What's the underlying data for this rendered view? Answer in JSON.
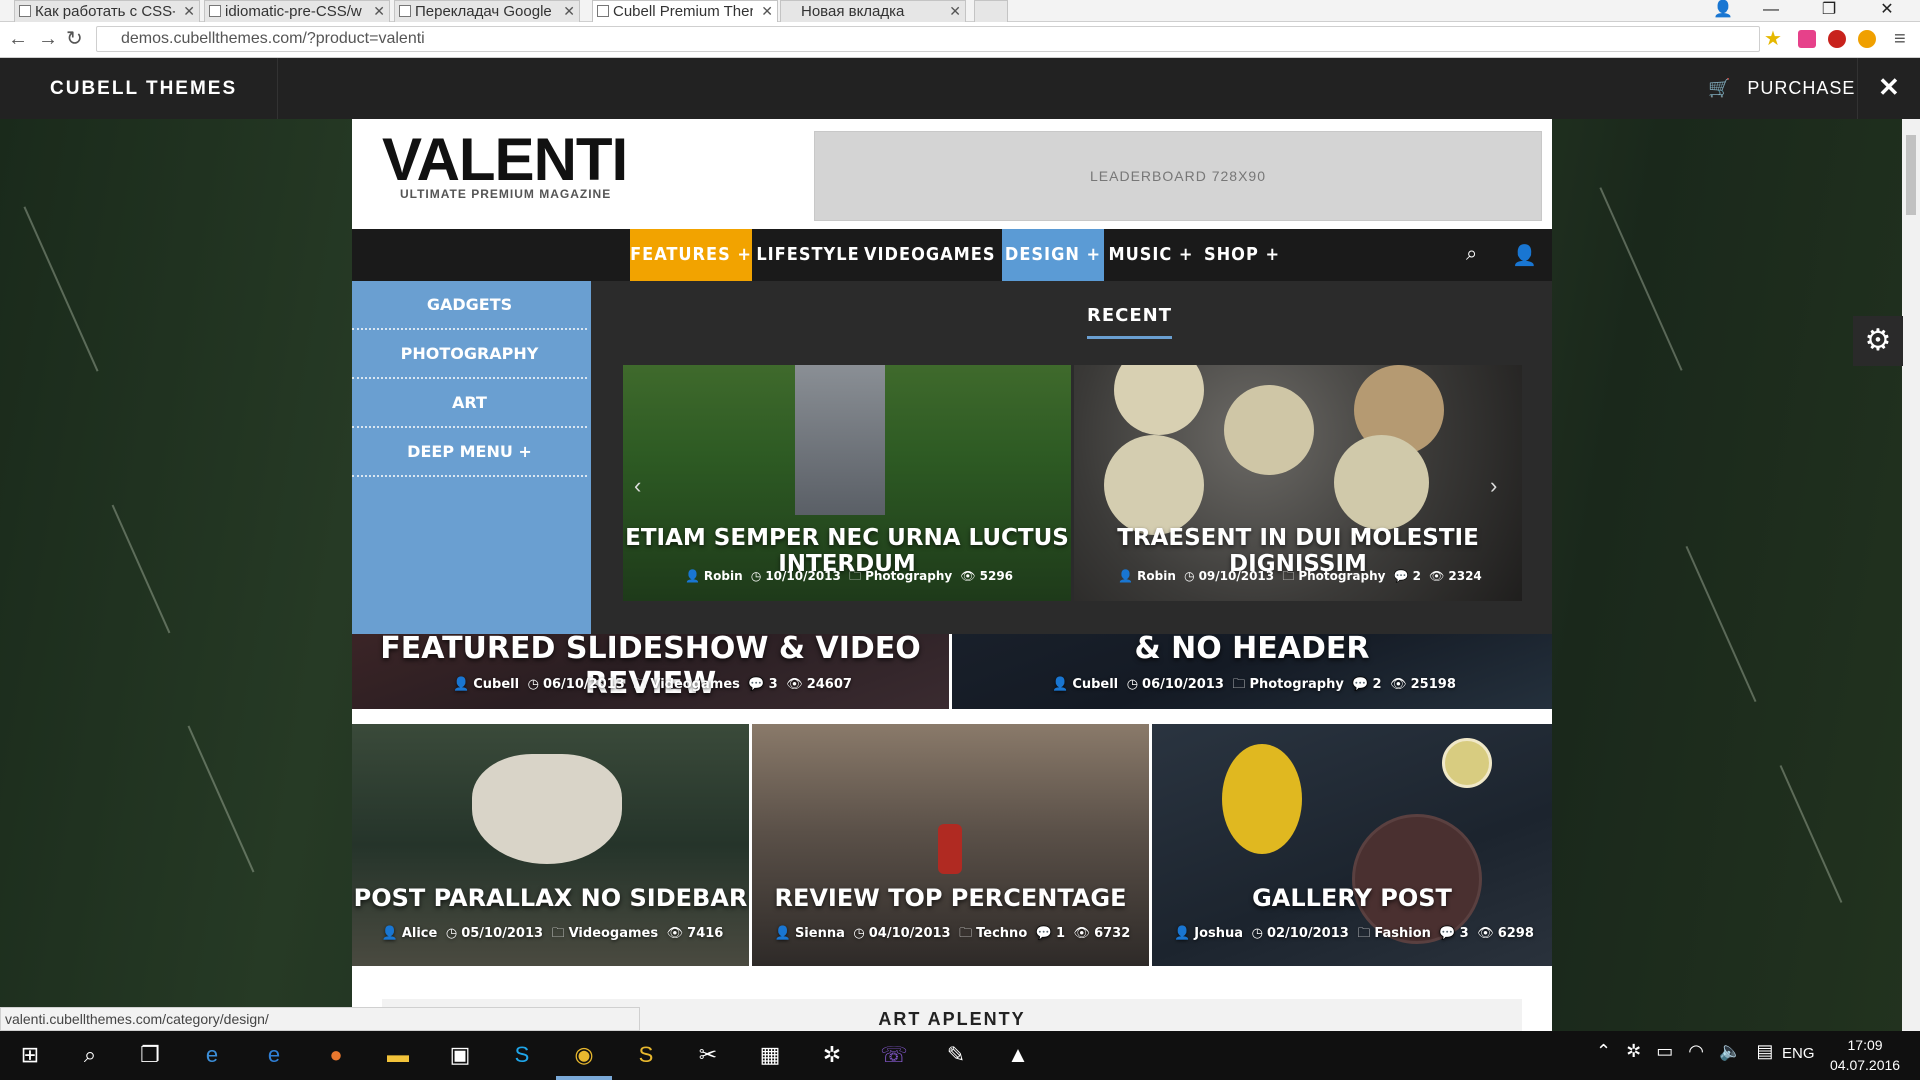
{
  "browser": {
    "tabs": [
      {
        "title": "Как работать с CSS-"
      },
      {
        "title": "idiomatic-pre-CSS/w"
      },
      {
        "title": "Перекладач Google"
      },
      {
        "title": "Cubell Premium Ther"
      },
      {
        "title": "Новая вкладка"
      }
    ],
    "url": "demos.cubellthemes.com/?product=valenti",
    "status_url": "valenti.cubellthemes.com/category/design/"
  },
  "sitebar": {
    "brand": "CUBELL THEMES",
    "purchase": "PURCHASE"
  },
  "logo": {
    "main": "VALENTI",
    "sub": "ULTIMATE PREMIUM MAGAZINE"
  },
  "leaderboard": "LEADERBOARD 728X90",
  "nav": {
    "items": [
      {
        "label": "FEATURES +"
      },
      {
        "label": "LIFESTYLE +"
      },
      {
        "label": "VIDEOGAMES"
      },
      {
        "label": "DESIGN +"
      },
      {
        "label": "MUSIC +"
      },
      {
        "label": "SHOP +"
      }
    ]
  },
  "submenu": {
    "items": [
      {
        "label": "GADGETS"
      },
      {
        "label": "PHOTOGRAPHY"
      },
      {
        "label": "ART"
      },
      {
        "label": "DEEP MENU +"
      }
    ]
  },
  "recent": {
    "title": "RECENT",
    "cards": [
      {
        "title": "ETIAM SEMPER NEC URNA LUCTUS INTERDUM",
        "author": "Robin",
        "date": "10/10/2013",
        "category": "Photography",
        "comments": "",
        "views": "5296"
      },
      {
        "title": "TRAESENT IN DUI MOLESTIE DIGNISSIM",
        "author": "Robin",
        "date": "09/10/2013",
        "category": "Photography",
        "comments": "2",
        "views": "2324"
      }
    ]
  },
  "featured": [
    {
      "title": "FEATURED SLIDESHOW & VIDEO REVIEW",
      "author": "Cubell",
      "date": "06/10/2013",
      "category": "Videogames",
      "comments": "3",
      "views": "24607"
    },
    {
      "title": "& NO HEADER",
      "author": "Cubell",
      "date": "06/10/2013",
      "category": "Photography",
      "comments": "2",
      "views": "25198"
    }
  ],
  "posts": [
    {
      "title": "POST PARALLAX NO SIDEBAR",
      "author": "Alice",
      "date": "05/10/2013",
      "category": "Videogames",
      "comments": "",
      "views": "7416"
    },
    {
      "title": "REVIEW TOP PERCENTAGE",
      "author": "Sienna",
      "date": "04/10/2013",
      "category": "Techno",
      "comments": "1",
      "views": "6732"
    },
    {
      "title": "GALLERY POST",
      "author": "Joshua",
      "date": "02/10/2013",
      "category": "Fashion",
      "comments": "3",
      "views": "6298"
    }
  ],
  "bottom_label": "ART APLENTY",
  "taskbar": {
    "lang": "ENG",
    "time": "17:09",
    "date": "04.07.2016"
  },
  "colors": {
    "features": "#f2a300",
    "design": "#5b9bd5",
    "submenu": "#6a9fd1"
  }
}
